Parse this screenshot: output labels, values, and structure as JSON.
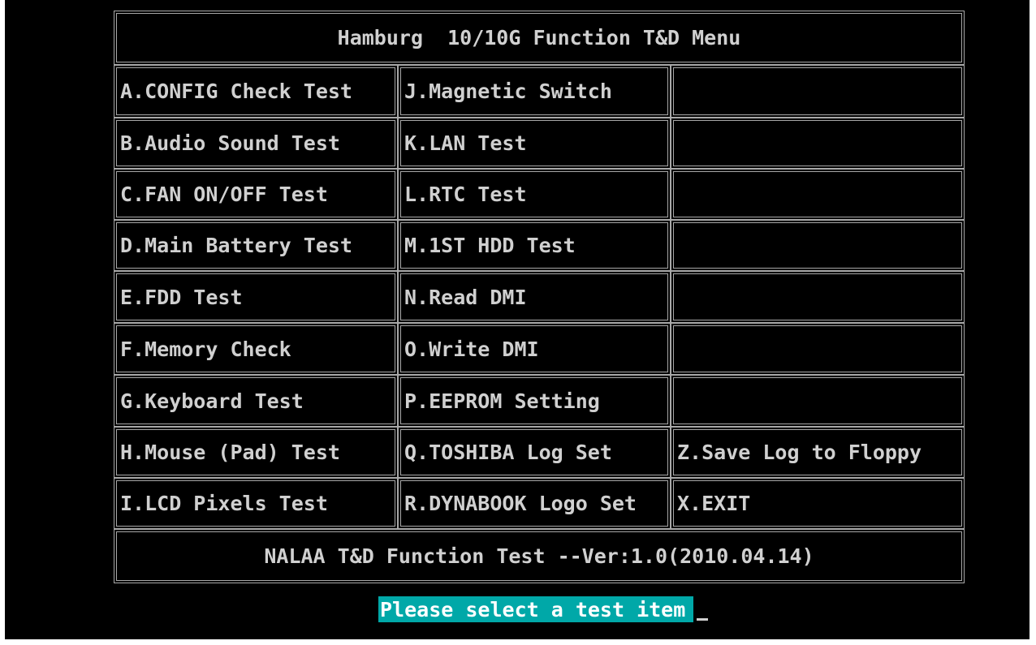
{
  "menu": {
    "title": "Hamburg  10/10G Function T&D Menu",
    "footer": "NALAA T&D Function Test --Ver:1.0(2010.04.14)",
    "col1": [
      "A.CONFIG Check Test",
      "B.Audio Sound Test",
      "C.FAN ON/OFF Test",
      "D.Main Battery Test",
      "E.FDD Test",
      "F.Memory Check",
      "G.Keyboard Test",
      "H.Mouse (Pad) Test",
      "I.LCD Pixels Test"
    ],
    "col2": [
      "J.Magnetic Switch",
      "K.LAN Test",
      "L.RTC Test",
      "M.1ST HDD Test",
      "N.Read DMI",
      "O.Write DMI",
      "P.EEPROM Setting",
      "Q.TOSHIBA Log Set",
      "R.DYNABOOK Logo Set"
    ],
    "col3": [
      "",
      "",
      "",
      "",
      "",
      "",
      "",
      "Z.Save Log to Floppy",
      "X.EXIT"
    ]
  },
  "prompt": {
    "text": "Please select a test item"
  },
  "colors": {
    "background": "#000000",
    "text": "#d0d0d0",
    "border": "#a8a8a8",
    "prompt_bg": "#00a8a8",
    "prompt_text": "#ffffff"
  }
}
